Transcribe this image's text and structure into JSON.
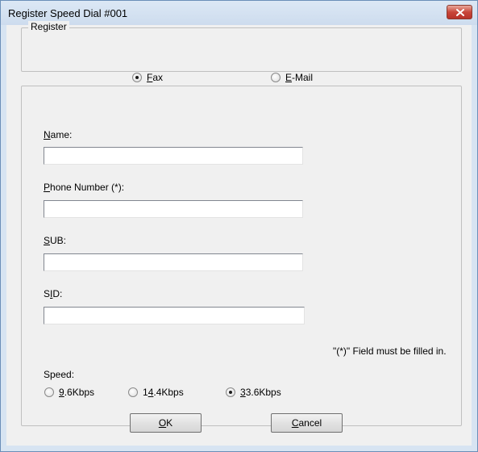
{
  "window": {
    "title": "Register Speed Dial #001"
  },
  "register_group": {
    "legend": "Register",
    "options": [
      {
        "accel": "F",
        "rest": "ax",
        "checked": true
      },
      {
        "accel": "E",
        "rest": "-Mail",
        "checked": false
      }
    ]
  },
  "fields": {
    "name": {
      "accel": "N",
      "rest": "ame:",
      "value": ""
    },
    "phone": {
      "accel": "P",
      "rest": "hone Number (*):",
      "value": ""
    },
    "sub": {
      "accel": "S",
      "rest": "UB:",
      "value": ""
    },
    "sid": {
      "pre": "S",
      "accel": "I",
      "rest": "D:",
      "value": ""
    }
  },
  "note": "\"(*)\" Field must be filled in.",
  "speed": {
    "label": "Speed:",
    "options": [
      {
        "pre": "",
        "accel": "9",
        "rest": ".6Kbps",
        "checked": false
      },
      {
        "pre": "1",
        "accel": "4",
        "rest": ".4Kbps",
        "checked": false
      },
      {
        "pre": "",
        "accel": "3",
        "rest": "3.6Kbps",
        "checked": true
      }
    ]
  },
  "buttons": {
    "ok": {
      "accel": "O",
      "rest": "K"
    },
    "cancel": {
      "accel": "C",
      "rest": "ancel"
    }
  }
}
